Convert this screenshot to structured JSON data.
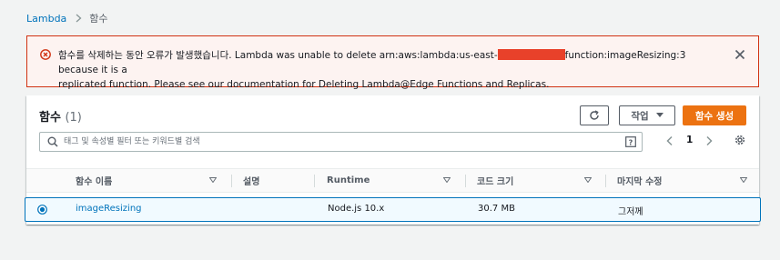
{
  "breadcrumb": {
    "root": "Lambda",
    "current": "함수"
  },
  "flash": {
    "line1_before": "함수를 삭제하는 동안 오류가 발생했습니다. Lambda was unable to delete arn:aws:lambda:us-east-",
    "line1_after": "function:imageResizing:3 because it is a",
    "line2": "replicated function. Please see our documentation for Deleting Lambda@Edge Functions and Replicas.",
    "status_color": "#d13212"
  },
  "panel": {
    "title": "함수",
    "count": "(1)",
    "actions_label": "작업",
    "create_label": "함수 생성"
  },
  "search": {
    "placeholder": "태그 및 속성별 필터 또는 키워드별 검색",
    "value": ""
  },
  "pagination": {
    "current_page": "1"
  },
  "table": {
    "columns": [
      "함수 이름",
      "설명",
      "Runtime",
      "코드 크기",
      "마지막 수정"
    ],
    "rows": [
      {
        "name": "imageResizing",
        "description": "",
        "runtime": "Node.js 10.x",
        "code_size": "30.7 MB",
        "last_modified": "그저께",
        "selected": true
      }
    ]
  },
  "colors": {
    "accent": "#0073bb",
    "primary_button": "#ec7211",
    "error": "#d13212"
  }
}
